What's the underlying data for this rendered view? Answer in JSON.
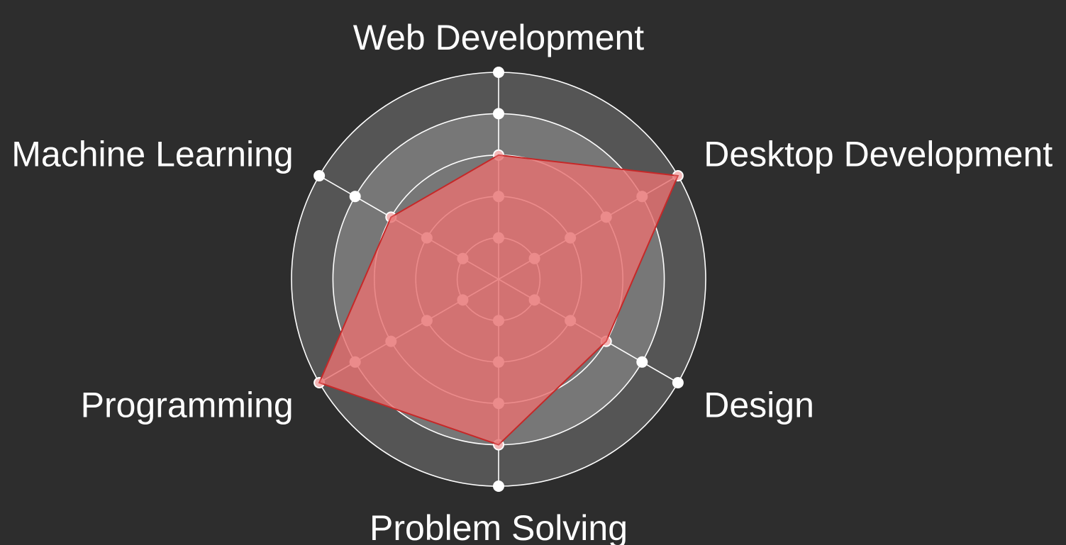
{
  "chart_data": {
    "type": "radar",
    "axes": [
      "Web Development",
      "Desktop Development",
      "Design",
      "Problem Solving",
      "Programming",
      "Machine Learning"
    ],
    "levels": 5,
    "max": 5,
    "series": [
      {
        "values": [
          3,
          5,
          3,
          4,
          5,
          3
        ]
      }
    ],
    "grid": true,
    "legend": "none",
    "colors": {
      "background": "#2d2d2d",
      "ring_outer": "#555555",
      "ring_inner": "#777777",
      "ring_stroke": "#ffffff",
      "series_fill": "#e77272",
      "series_stroke": "#c62828",
      "dot": "#ffffff"
    }
  }
}
